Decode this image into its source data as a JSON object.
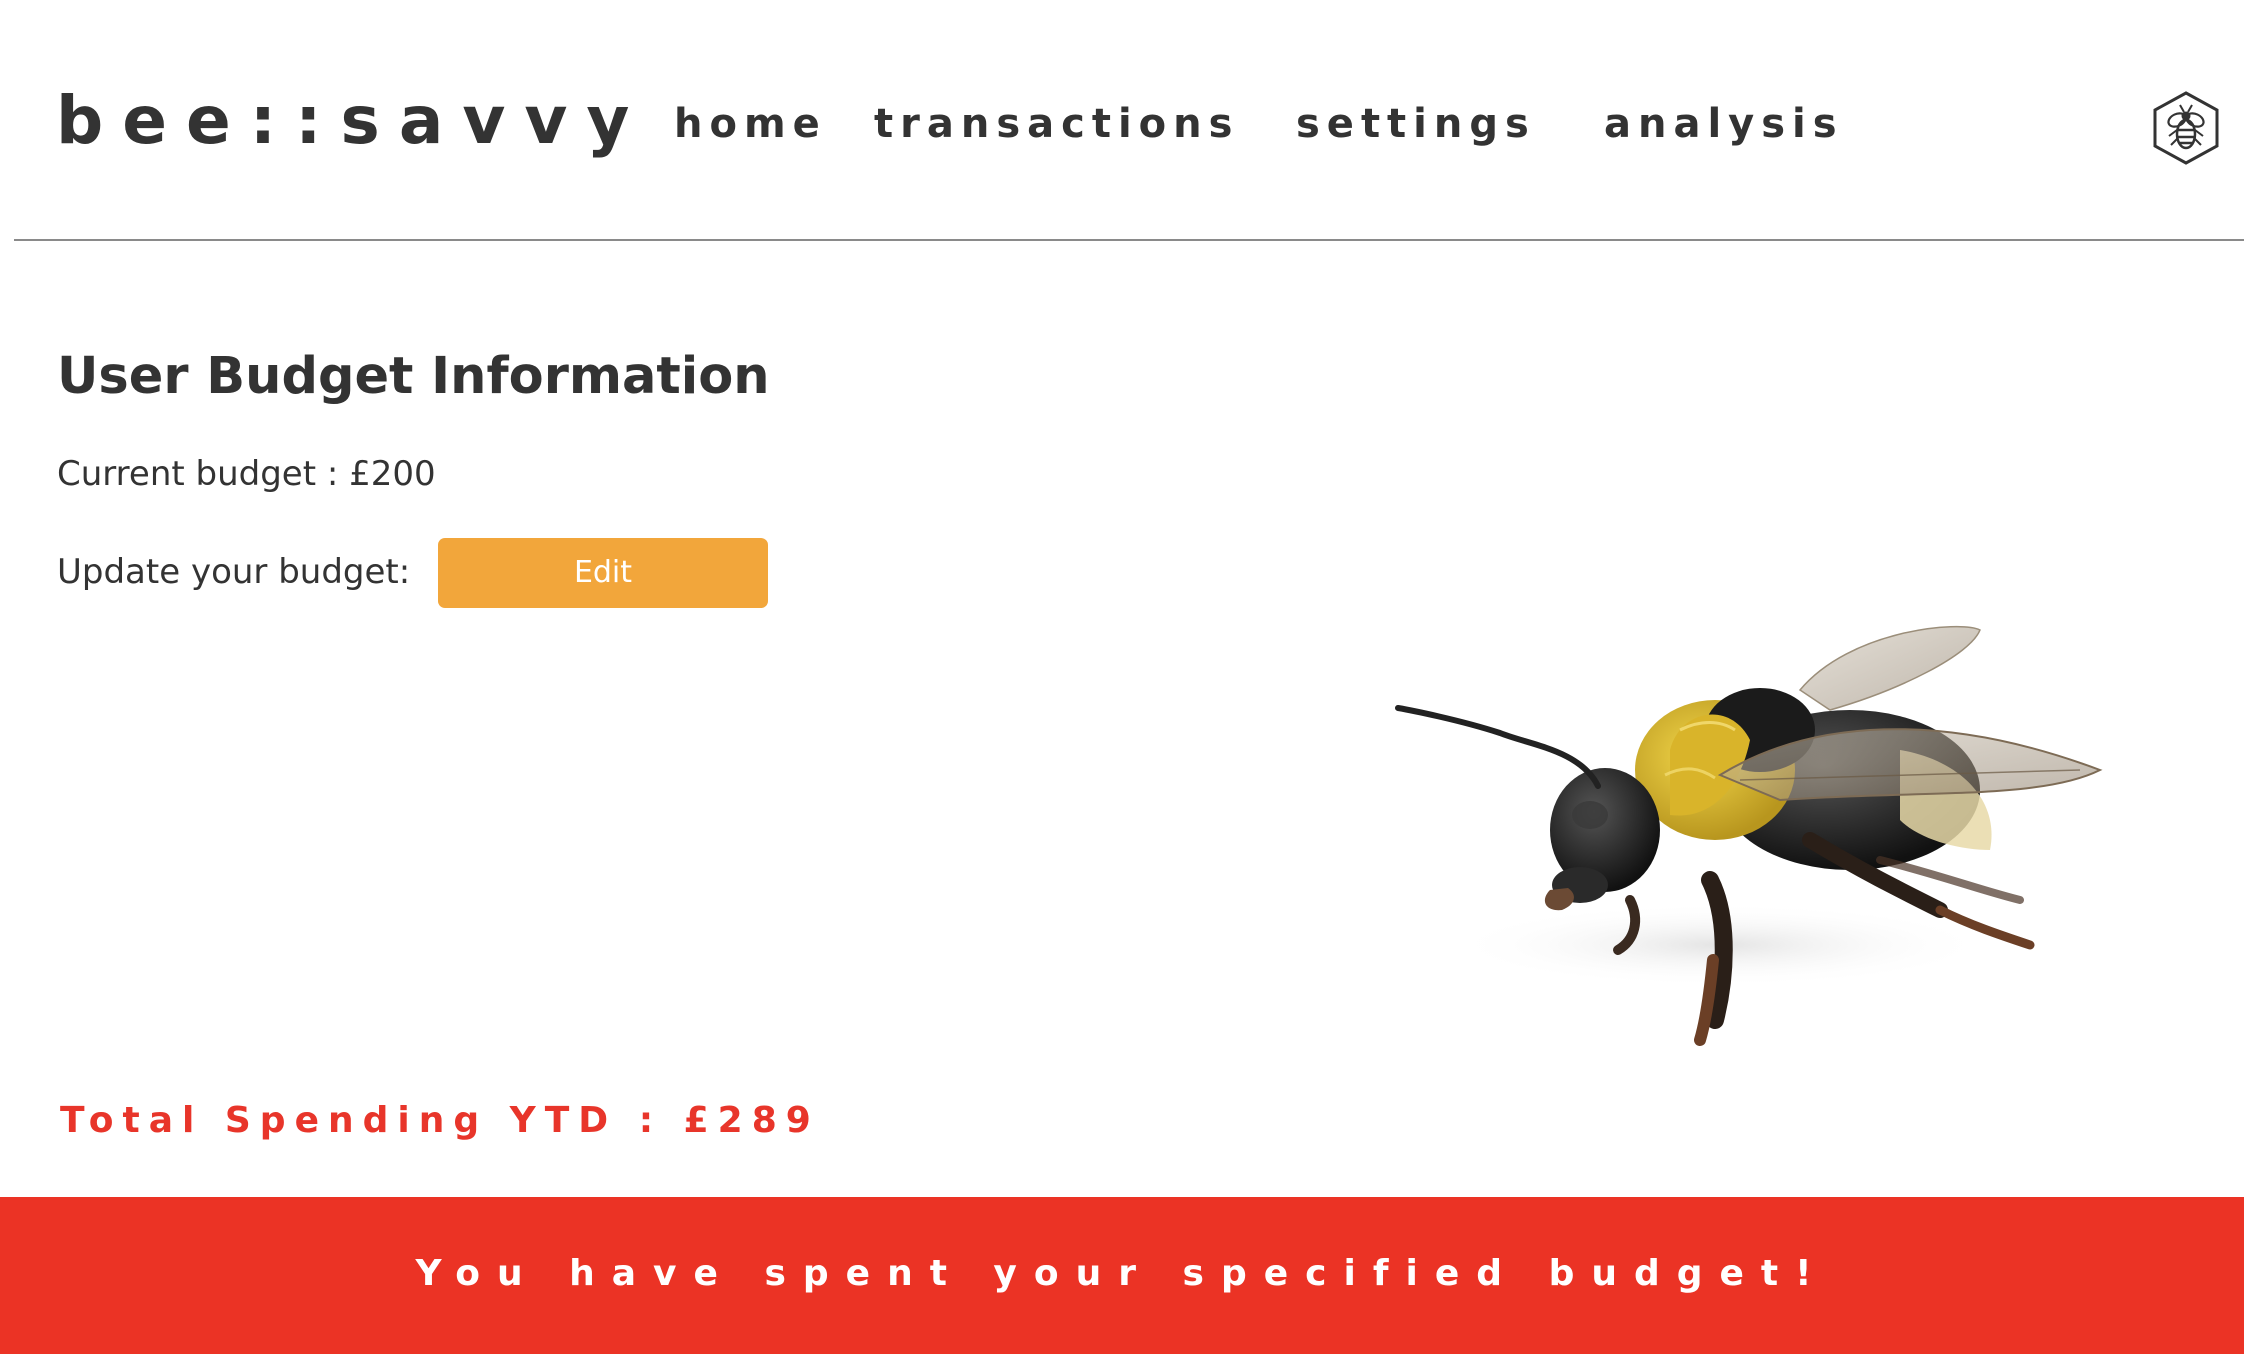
{
  "app": {
    "logo": "bee::savvy"
  },
  "nav": {
    "items": [
      {
        "label": "home"
      },
      {
        "label": "transactions"
      },
      {
        "label": "settings"
      },
      {
        "label": "analysis"
      }
    ],
    "badge_icon": "bee-hexagon-icon"
  },
  "main": {
    "title": "User Budget Information",
    "current_budget": "Current budget : £200",
    "update_label": "Update your budget:",
    "edit_button_label": "Edit",
    "total_spending": "Total Spending YTD : £289"
  },
  "alert": {
    "message": "You have spent your specified budget!"
  },
  "colors": {
    "accent_orange": "#f2a63b",
    "alert_red": "#eb3325",
    "text_red": "#e8352a",
    "text_dark": "#333333"
  }
}
